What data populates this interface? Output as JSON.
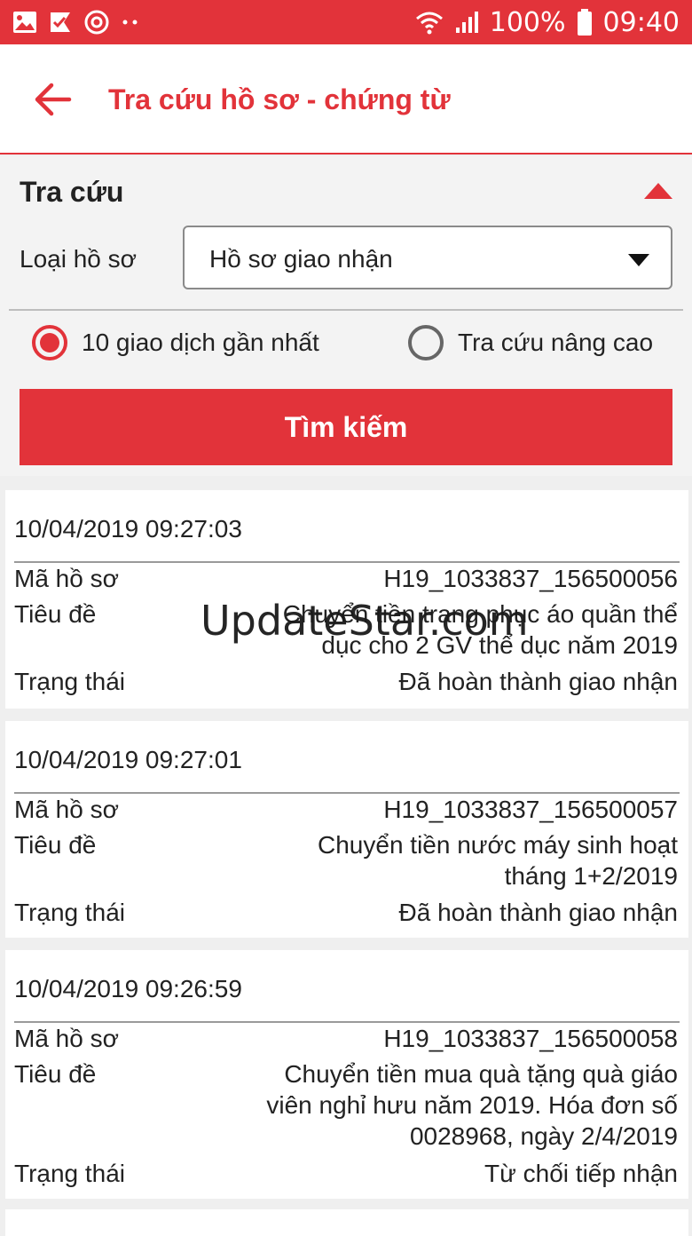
{
  "status_bar": {
    "battery": "100%",
    "time": "09:40",
    "left_icons": [
      "image-icon",
      "check-flag-icon",
      "sync-target-icon",
      "more-dots-icon"
    ],
    "right_icons": [
      "wifi-icon",
      "signal-icon",
      "battery-icon"
    ]
  },
  "header": {
    "title": "Tra cứu hồ sơ - chứng từ",
    "back_icon": "back-arrow-icon"
  },
  "search": {
    "section_title": "Tra cứu",
    "type_label": "Loại hồ sơ",
    "type_value": "Hồ sơ giao nhận",
    "radio_recent": "10 giao dịch gần nhất",
    "radio_advanced": "Tra cứu nâng cao",
    "selected_option": "radio_recent",
    "button_label": "Tìm kiếm"
  },
  "labels": {
    "code": "Mã hồ sơ",
    "title": "Tiêu đề",
    "status": "Trạng thái"
  },
  "results": [
    {
      "timestamp": "10/04/2019 09:27:03",
      "code": "H19_1033837_156500056",
      "title": "Chuyển tiền trang phục áo quần thể dục cho 2 GV thể dục năm 2019",
      "status": "Đã hoàn thành giao nhận"
    },
    {
      "timestamp": "10/04/2019 09:27:01",
      "code": "H19_1033837_156500057",
      "title": "Chuyển tiền nước máy sinh hoạt tháng 1+2/2019",
      "status": "Đã hoàn thành giao nhận"
    },
    {
      "timestamp": "10/04/2019 09:26:59",
      "code": "H19_1033837_156500058",
      "title": "Chuyển tiền mua quà tặng quà giáo viên nghỉ hưu năm 2019. Hóa đơn số 0028968, ngày 2/4/2019",
      "status": "Từ chối tiếp nhận"
    }
  ],
  "watermark": "UpdateStar.com",
  "colors": {
    "accent": "#e2333a",
    "background": "#efefef",
    "panel": "#f3f3f3"
  }
}
